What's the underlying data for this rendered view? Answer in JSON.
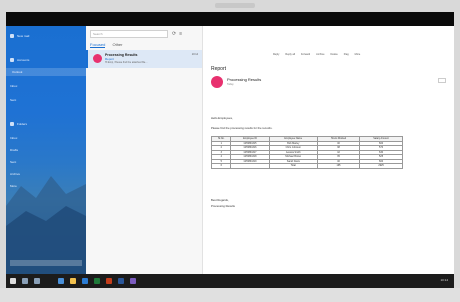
{
  "nav": {
    "items": [
      {
        "label": "New mail"
      },
      {
        "label": "Accounts"
      },
      {
        "label": "Outlook"
      },
      {
        "label": "Inbox"
      },
      {
        "label": "Sent"
      },
      {
        "label": "Folders"
      },
      {
        "label": "Inbox"
      },
      {
        "label": "Drafts"
      },
      {
        "label": "Sent"
      },
      {
        "label": "Archive"
      },
      {
        "label": "More"
      }
    ]
  },
  "list": {
    "search_placeholder": "Search",
    "tabs": [
      "Focused",
      "Other"
    ],
    "message": {
      "from": "Processing Results",
      "subject": "Report",
      "preview": "Hi Emp, Please find the attached file...",
      "time": "10:14"
    }
  },
  "reading": {
    "title": "Report",
    "from": "Processing Results",
    "date": "Today",
    "toolbar": [
      "Reply",
      "Reply all",
      "Forward",
      "Archive",
      "Delete",
      "Flag",
      "More"
    ],
    "greeting": "Hello Employees,",
    "intro": "Please find the processing results for the records.",
    "signoff": "Best Regards,",
    "signature": "Processing Results",
    "table": {
      "headers": [
        "Sl.No.",
        "Employee ID",
        "Employee Name",
        "Hours Worked",
        "Salary Amount"
      ],
      "rows": [
        [
          "1",
          "GH9864315",
          "Bob Marley",
          "40",
          "600"
        ],
        [
          "2",
          "GH9864316",
          "Chris Johnson",
          "38",
          "570"
        ],
        [
          "3",
          "GH9864317",
          "Jessica Smith",
          "42",
          "630"
        ],
        [
          "4",
          "GH9864318",
          "Michael Brown",
          "35",
          "525"
        ],
        [
          "5",
          "GH9864319",
          "Sarah Davis",
          "40",
          "600"
        ],
        [
          "6",
          "",
          "Total",
          "195",
          "2925"
        ]
      ]
    }
  },
  "taskbar": {
    "clock": "10:14"
  }
}
